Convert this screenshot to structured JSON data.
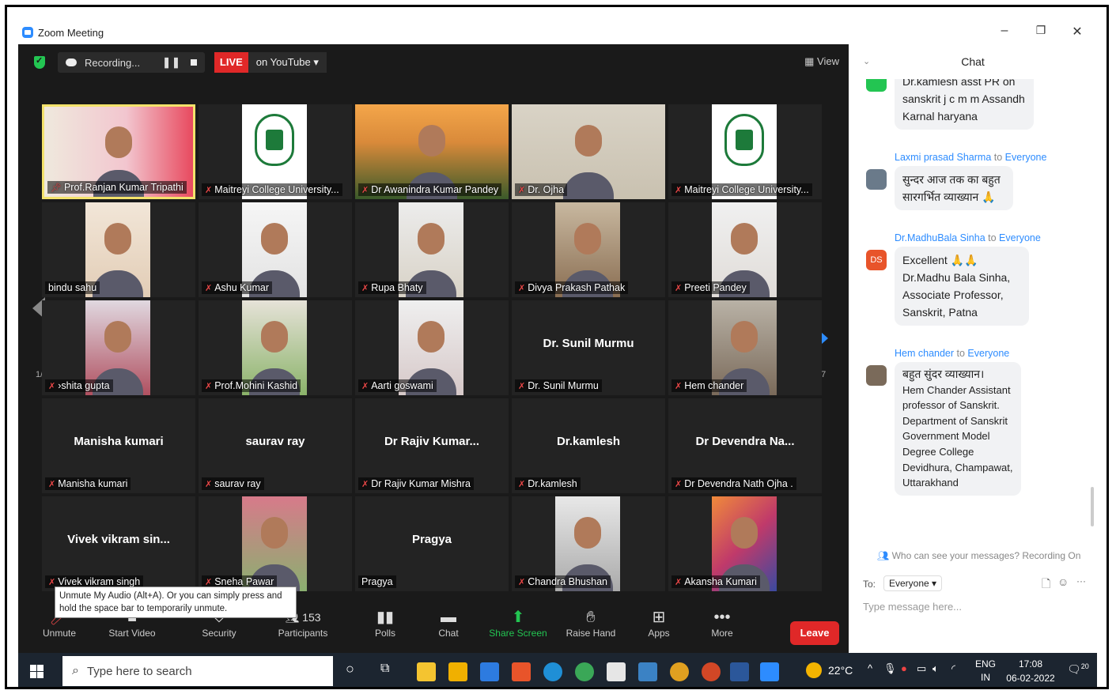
{
  "window": {
    "title": "Zoom Meeting"
  },
  "topbar": {
    "recording_label": "Recording...",
    "live_badge": "LIVE",
    "youtube_label": "on YouTube ▾",
    "view_label": "View"
  },
  "gallery": {
    "page_left": "1/7",
    "page_right": "1/7",
    "tiles": [
      {
        "name": "Prof.Ranjan Kumar Tripathi",
        "display": ""
      },
      {
        "name": "Maitreyi College University...",
        "display": ""
      },
      {
        "name": "Dr Awanindra Kumar Pandey",
        "display": ""
      },
      {
        "name": "Dr. Ojha",
        "display": ""
      },
      {
        "name": "Maitreyi College University...",
        "display": ""
      },
      {
        "name": "bindu sahu",
        "display": ""
      },
      {
        "name": "Ashu Kumar",
        "display": ""
      },
      {
        "name": "Rupa Bhaty",
        "display": ""
      },
      {
        "name": "Divya Prakash Pathak",
        "display": ""
      },
      {
        "name": "Preeti Pandey",
        "display": ""
      },
      {
        "name": "›shita gupta",
        "display": ""
      },
      {
        "name": "Prof.Mohini Kashid",
        "display": ""
      },
      {
        "name": "Aarti goswami",
        "display": ""
      },
      {
        "name": "Dr. Sunil Murmu",
        "display": "Dr. Sunil Murmu"
      },
      {
        "name": "Hem chander",
        "display": ""
      },
      {
        "name": "Manisha kumari",
        "display": "Manisha kumari"
      },
      {
        "name": "saurav ray",
        "display": "saurav ray"
      },
      {
        "name": "Dr Rajiv Kumar Mishra",
        "display": "Dr Rajiv Kumar..."
      },
      {
        "name": "Dr.kamlesh",
        "display": "Dr.kamlesh"
      },
      {
        "name": "Dr Devendra Nath Ojha .",
        "display": "Dr Devendra Na..."
      },
      {
        "name": "Vivek vikram singh",
        "display": "Vivek vikram sin..."
      },
      {
        "name": "Sneha Pawar",
        "display": ""
      },
      {
        "name": "Pragya",
        "display": "Pragya"
      },
      {
        "name": "Chandra Bhushan",
        "display": ""
      },
      {
        "name": "Akansha Kumari",
        "display": ""
      }
    ]
  },
  "tooltip": {
    "text": "Unmute My Audio (Alt+A). Or you can simply press and hold the space bar to temporarily unmute."
  },
  "toolbar": {
    "unmute": "Unmute",
    "start_video": "Start Video",
    "security": "Security",
    "participants": "Participants",
    "participants_count": "153",
    "polls": "Polls",
    "chat": "Chat",
    "share_screen": "Share Screen",
    "raise_hand": "Raise Hand",
    "apps": "Apps",
    "more": "More",
    "leave": "Leave"
  },
  "chat": {
    "title": "Chat",
    "messages": [
      {
        "from": "",
        "to": "",
        "text": "Dr.kamlesh asst PR on sanskrit j c m m Assandh Karnal haryana"
      },
      {
        "from": "Laxmi prasad Sharma",
        "to": "Everyone",
        "text": "सुन्दर आज तक का बहुत सारगर्भित व्याख्यान 🙏"
      },
      {
        "from": "Dr.MadhuBala Sinha",
        "to": "Everyone",
        "avatar": "DS",
        "text": "Excellent 🙏🙏 Dr.Madhu Bala Sinha, Associate Professor, Sanskrit, Patna"
      },
      {
        "from": "Hem chander",
        "to": "Everyone",
        "text_head": "बहुत सुंदर व्याख्यान।",
        "text": "Hem Chander Assistant professor of Sanskrit. Department of Sanskrit Government Model Degree College Devidhura, Champawat, Uttarakhand"
      }
    ],
    "to_word": "to",
    "who_can_see": "Who can see your messages? Recording On",
    "to_label": "To:",
    "to_value": "Everyone ▾",
    "placeholder": "Type message here..."
  },
  "taskbar": {
    "search_placeholder": "Type here to search",
    "weather": "22°C",
    "lang_top": "ENG",
    "lang_bottom": "IN",
    "time": "17:08",
    "date": "06-02-2022",
    "notif_count": "20"
  }
}
